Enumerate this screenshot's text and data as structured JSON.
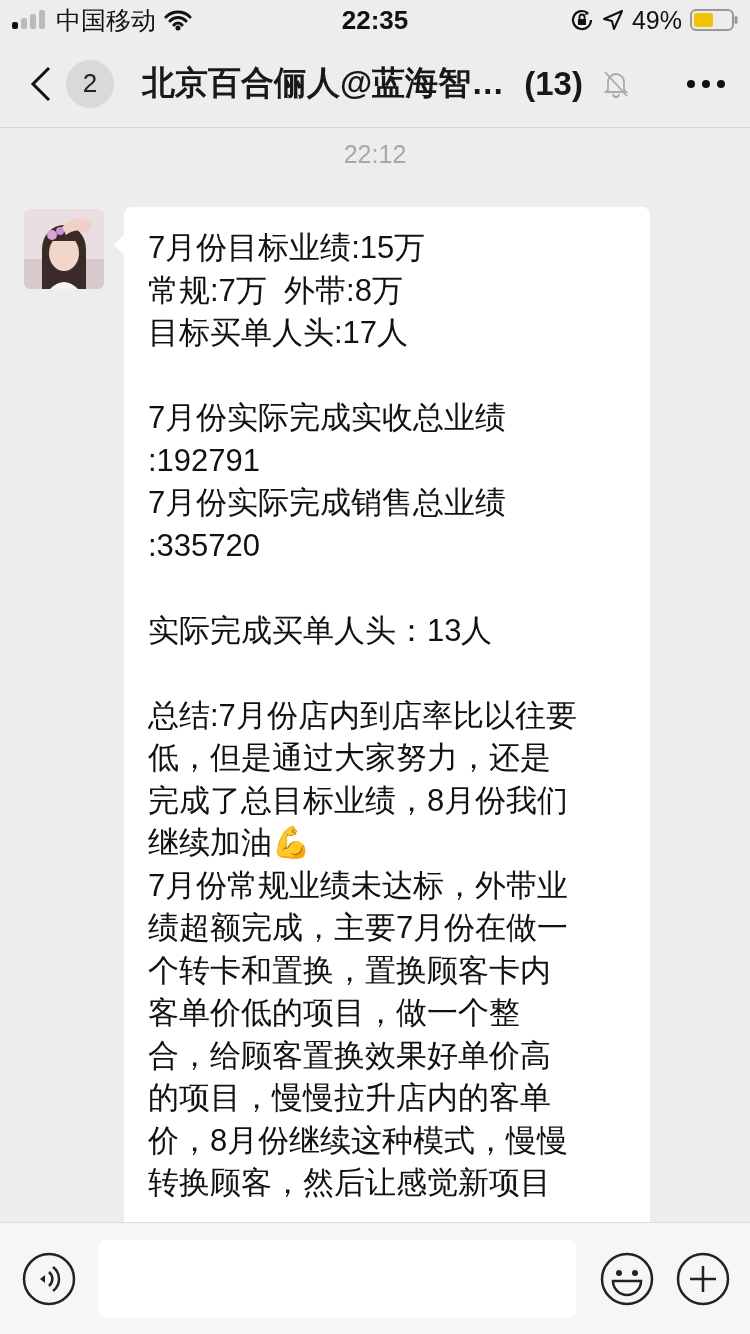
{
  "status_bar": {
    "carrier": "中国移动",
    "time": "22:35",
    "battery": "49%"
  },
  "header": {
    "back_count": "2",
    "title": "北京百合俪人@蓝海智…",
    "member_count": "(13)",
    "muted": true
  },
  "timestamp": "22:12",
  "message": {
    "paragraphs": [
      {
        "lines": [
          "7月份目标业绩:15万",
          "常规:7万  外带:8万",
          "目标买单人头:17人"
        ]
      },
      {
        "lines": [
          "7月份实际完成实收总业绩",
          ":192791",
          "7月份实际完成销售总业绩",
          ":335720"
        ]
      },
      {
        "lines": [
          "实际完成买单人头：13人"
        ]
      },
      {
        "lines": [
          "总结:7月份店内到店率比以往要",
          "低，但是通过大家努力，还是",
          "完成了总目标业绩，8月份我们",
          "继续加油💪",
          "7月份常规业绩未达标，外带业",
          "绩超额完成，主要7月份在做一",
          "个转卡和置换，置换顾客卡内",
          "客单价低的项目，做一个整",
          "合，给顾客置换效果好单价高",
          "的项目，慢慢拉升店内的客单",
          "价，8月份继续这种模式，慢慢",
          "转换顾客，然后让感觉新项目"
        ]
      }
    ]
  }
}
